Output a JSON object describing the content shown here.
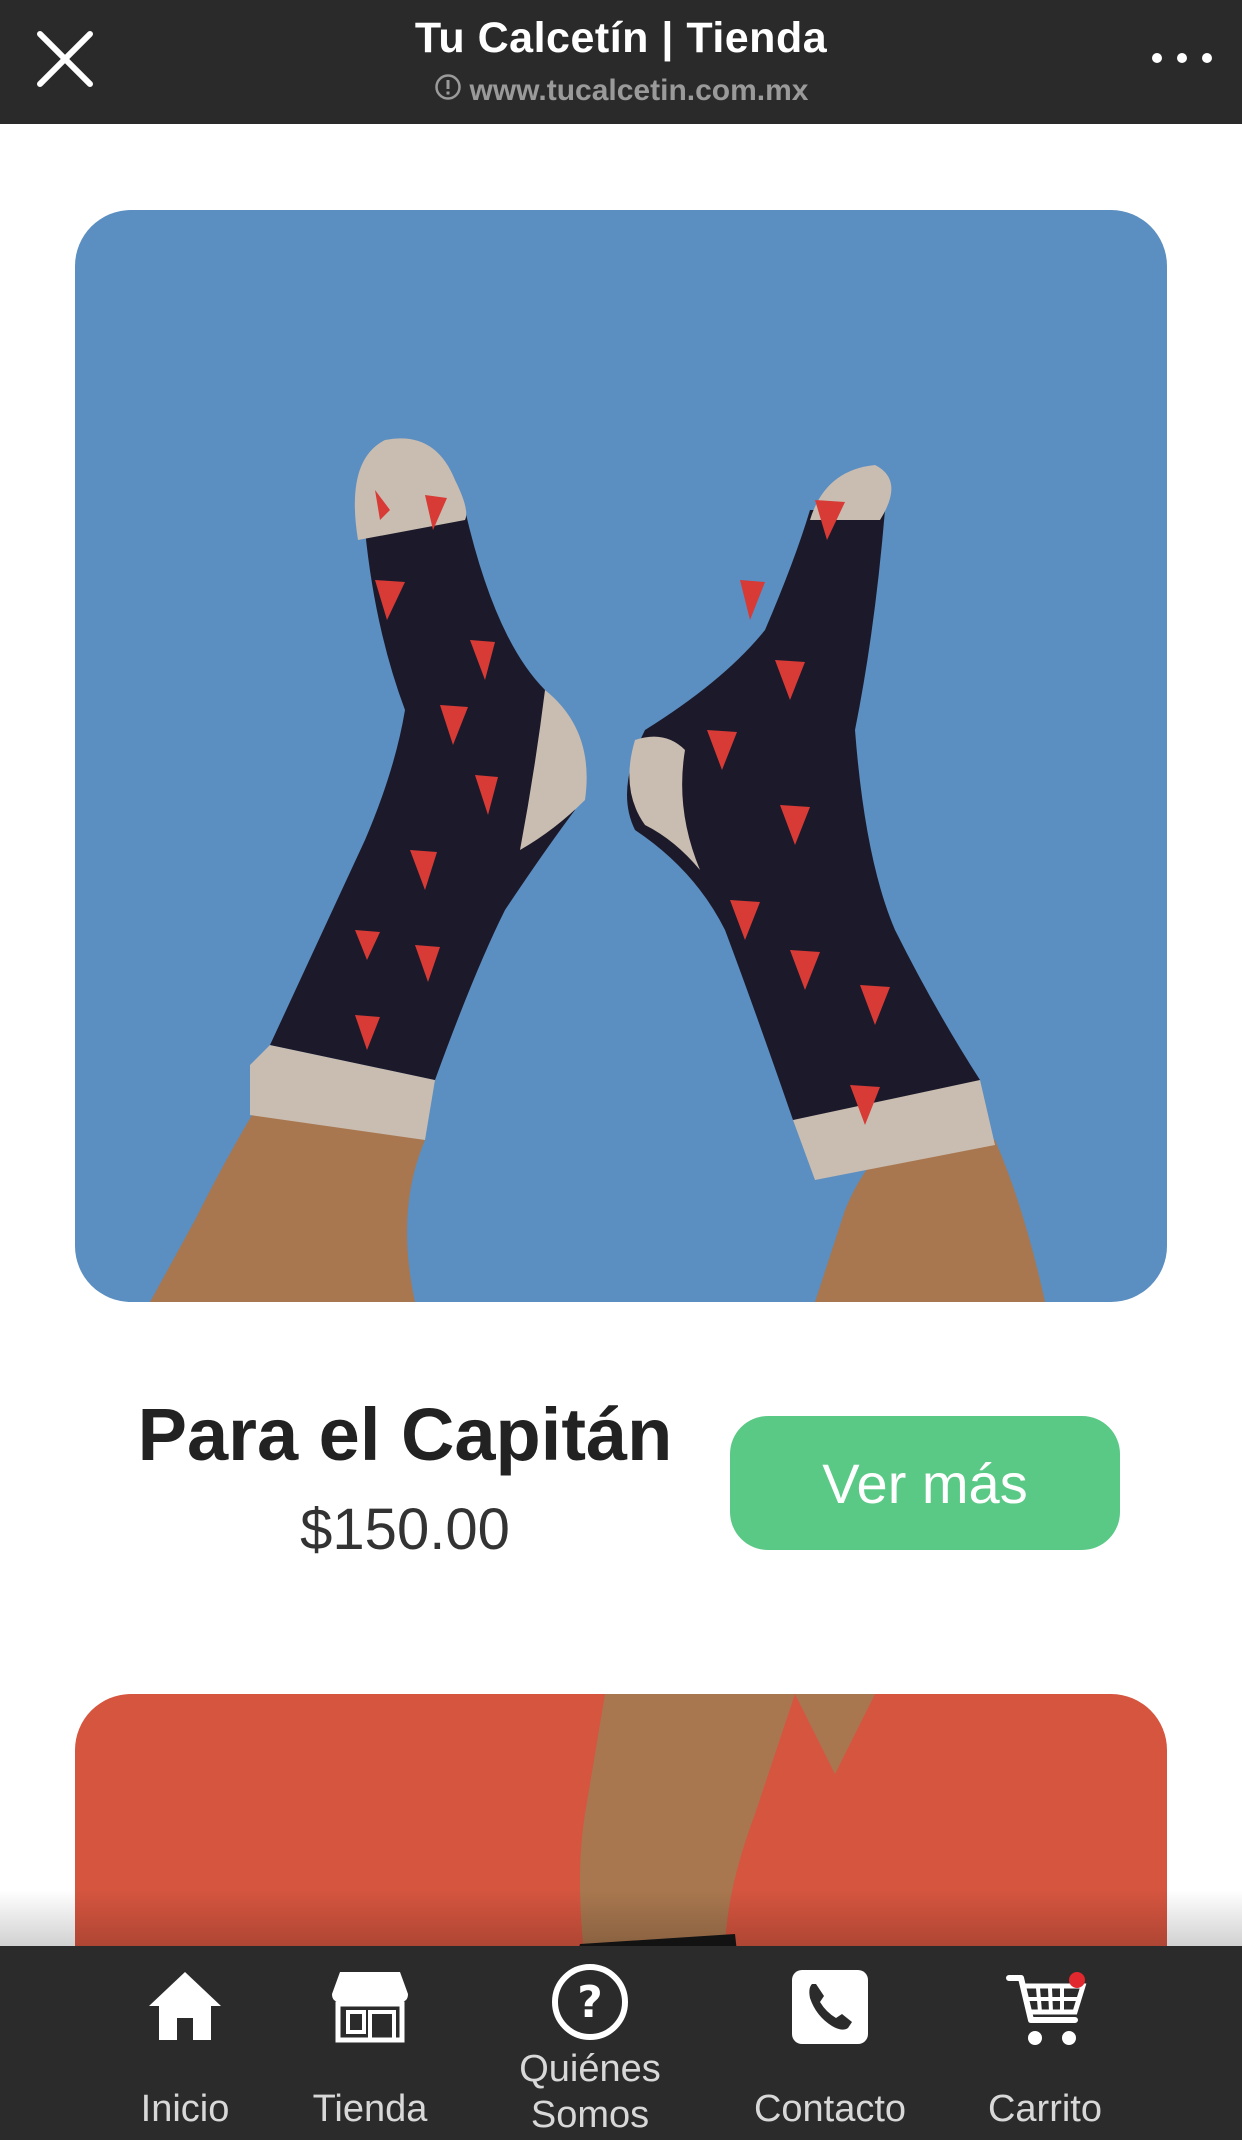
{
  "header": {
    "title": "Tu Calcetín | Tienda",
    "url": "www.tucalcetin.com.mx",
    "close_icon": "close-icon",
    "more_icon": "more-dots-icon"
  },
  "product": {
    "name": "Para el Capitán",
    "price": "$150.00",
    "button_label": "Ver más",
    "image_bg": "#5b8ec1"
  },
  "next_product": {
    "image_bg": "#d5553f"
  },
  "colors": {
    "accent": "#5ac986",
    "bar": "#2a2a2a"
  },
  "bottom_nav": {
    "items": [
      {
        "label": "Inicio",
        "icon": "home-icon"
      },
      {
        "label": "Tienda",
        "icon": "store-icon"
      },
      {
        "label": "Quiénes",
        "label2": "Somos",
        "icon": "question-icon"
      },
      {
        "label": "Contacto",
        "icon": "phone-icon"
      },
      {
        "label": "Carrito",
        "icon": "cart-icon"
      }
    ]
  }
}
